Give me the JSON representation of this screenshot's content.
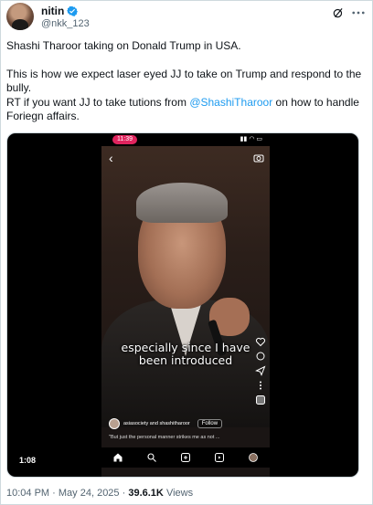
{
  "author": {
    "display_name": "nitin",
    "handle": "@nkk_123",
    "verified": true
  },
  "tweet": {
    "line1": "Shashi Tharoor taking on Donald Trump in USA.",
    "line2": "This is how we expect laser eyed JJ to take on Trump and respond to the bully.",
    "line3_pre": "RT if you want JJ to take tutions from ",
    "mention": "@ShashiTharoor",
    "line3_post": " on how to handle Foriegn affairs."
  },
  "video": {
    "duration": "1:08",
    "phone_time": "11:39",
    "caption_line1": "especially since I have",
    "caption_line2": "been introduced",
    "accounts": "asiasociety and shashitharoor",
    "follow_label": "Follow",
    "description": "\"But just the personal manner strikes me as not ..."
  },
  "footer": {
    "time": "10:04 PM",
    "separator": "·",
    "date": "May 24, 2025",
    "views_count": "39.6.1K",
    "views_label": "Views"
  },
  "colors": {
    "accent": "#1d9bf0",
    "text": "#0f1419",
    "secondary": "#536471",
    "border": "#cfd9de"
  }
}
